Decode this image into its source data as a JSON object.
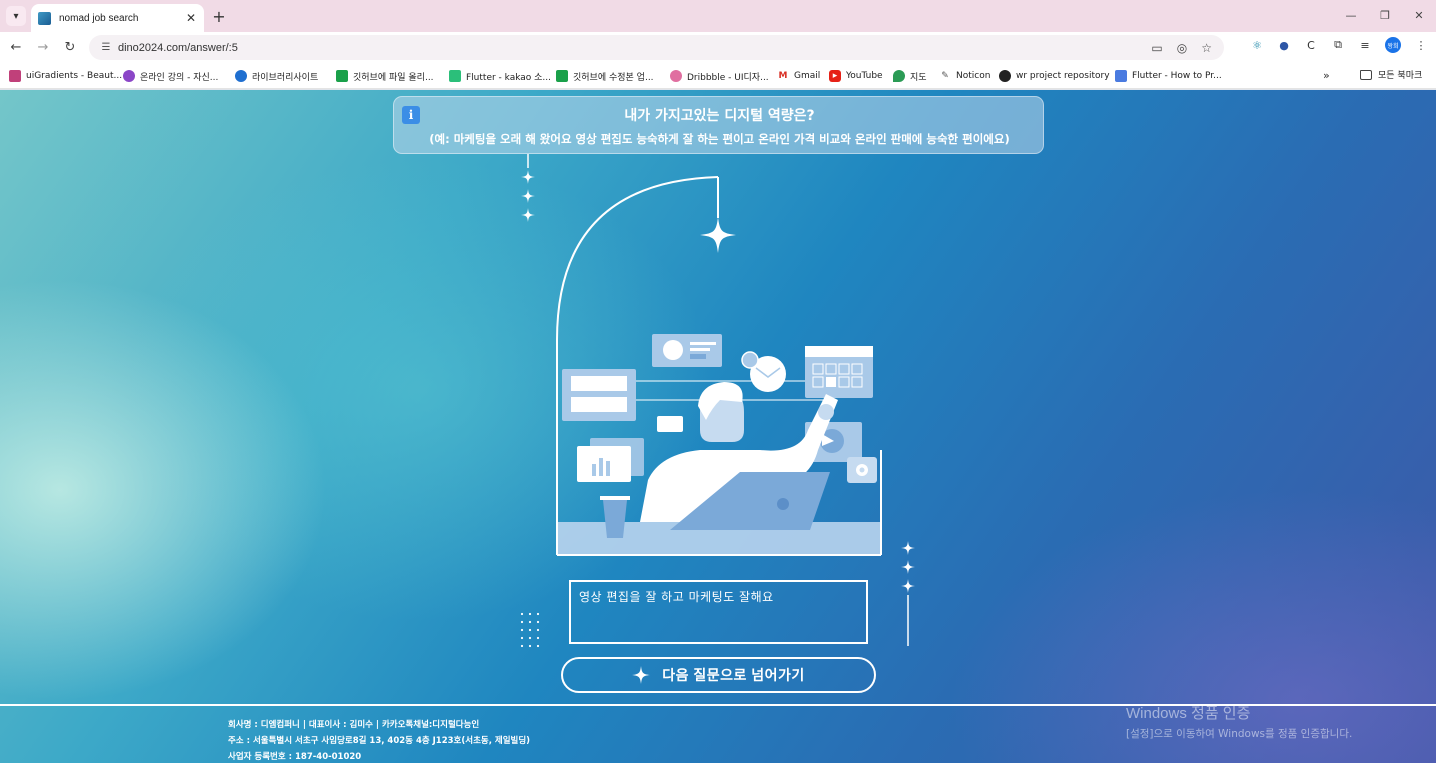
{
  "browser": {
    "tab_title": "nomad job search",
    "url": "dino2024.com/answer/:5",
    "profile_label": "왕희",
    "bookmarks": [
      {
        "label": "uiGradients - Beaut...",
        "color": "#c0407a"
      },
      {
        "label": "온라인 강의 - 자신...",
        "color": "#8b46c7"
      },
      {
        "label": "라이브러리사이트",
        "color": "#1f6fd0"
      },
      {
        "label": "깃허브에 파일 올리...",
        "color": "#1aa04a"
      },
      {
        "label": "Flutter - kakao 소...",
        "color": "#2bbf7a"
      },
      {
        "label": "깃허브에 수정본 업...",
        "color": "#1aa04a"
      },
      {
        "label": "Dribbble - UI디자...",
        "color": "#e06fa0"
      },
      {
        "label": "Gmail",
        "color": "#d93025"
      },
      {
        "label": "YouTube",
        "color": "#e62117"
      },
      {
        "label": "지도",
        "color": "#2b9b55"
      },
      {
        "label": "Noticon",
        "color": "#555555"
      },
      {
        "label": "wr project repository",
        "color": "#222222"
      },
      {
        "label": "Flutter - How to Pr...",
        "color": "#4a7be0"
      }
    ],
    "all_bookmarks": "모든 북마크"
  },
  "question": {
    "title": "내가 가지고있는 디지털 역량은?",
    "hint": "(예: 마케팅을 오래 해 왔어요 영상 편집도 능숙하게 잘 하는 편이고 온라인 가격 비교와 온라인 판매에 능숙한 편이에요)"
  },
  "answer": {
    "value": "영상 편집을 잘 하고 마케팅도 잘해요"
  },
  "next_button": {
    "label": "다음 질문으로 넘어가기"
  },
  "footer": {
    "company": "회사명 : 디엠컴퍼니 | 대표이사 : 김미수 | 카카오톡채널:디지털다능인",
    "address": "주소 : 서울특별시 서초구 사임당로8길 13, 402동 4층 J123호(서초동, 제일빌딩)",
    "business_no": "사업자 등록번호 : 187-40-01020"
  },
  "windows_activation": {
    "title": "Windows 정품 인증",
    "subtitle": "[설정]으로 이동하여 Windows를 정품 인증합니다."
  },
  "colors": {
    "accent": "#ffffff",
    "illustration_fill": "#a9c9e8"
  }
}
